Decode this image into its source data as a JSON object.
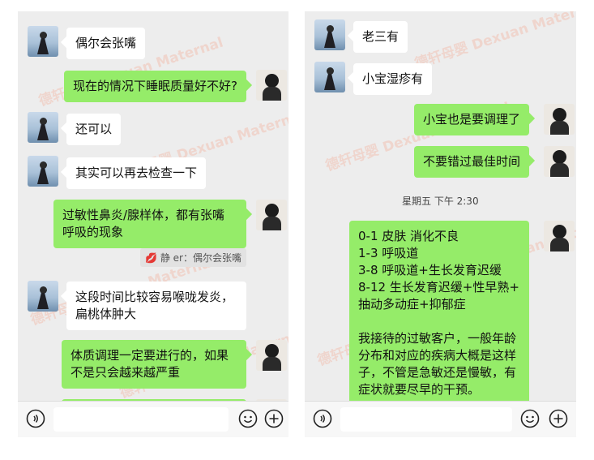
{
  "left_chat": {
    "watermark": "德轩母婴 Dexuan Maternal",
    "messages": [
      {
        "text": "偶尔会张嘴"
      },
      {
        "text": "现在的情况下睡眠质量好不好?"
      },
      {
        "text": "还可以"
      },
      {
        "text": "其实可以再去检查一下"
      },
      {
        "text": "过敏性鼻炎/腺样体，都有张嘴\n呼吸的现象"
      },
      {
        "text": "这段时间比较容易喉咙发炎，\n扁桃体肿大"
      },
      {
        "text": "体质调理一定要进行的，如果\n不是只会越来越严重"
      }
    ],
    "quote": {
      "emoji": "💋",
      "text": "静 er：偶尔会张嘴"
    }
  },
  "right_chat": {
    "messages": [
      {
        "text": "老三有"
      },
      {
        "text": "小宝湿疹有"
      },
      {
        "text": "小宝也是要调理了"
      },
      {
        "text": "不要错过最佳时间"
      },
      {
        "text": "0-1  皮肤 消化不良\n1-3  呼吸道\n3-8  呼吸道+生长发育迟缓\n8-12 生长发育迟缓+性早熟+\n抽动多动症+抑郁症\n\n我接待的过敏客户，一般年龄\n分布和对应的疾病大概是这样\n子，不管是急敏还是慢敏，有\n症状就要尽早的干预。"
      }
    ],
    "timestamp": "星期五 下午 2:30"
  },
  "colors": {
    "chat_bg": "#ededed",
    "sent_bubble": "#95ec69",
    "received_bubble": "#ffffff"
  },
  "icons": [
    "voice-icon",
    "emoji-icon",
    "plus-icon"
  ]
}
